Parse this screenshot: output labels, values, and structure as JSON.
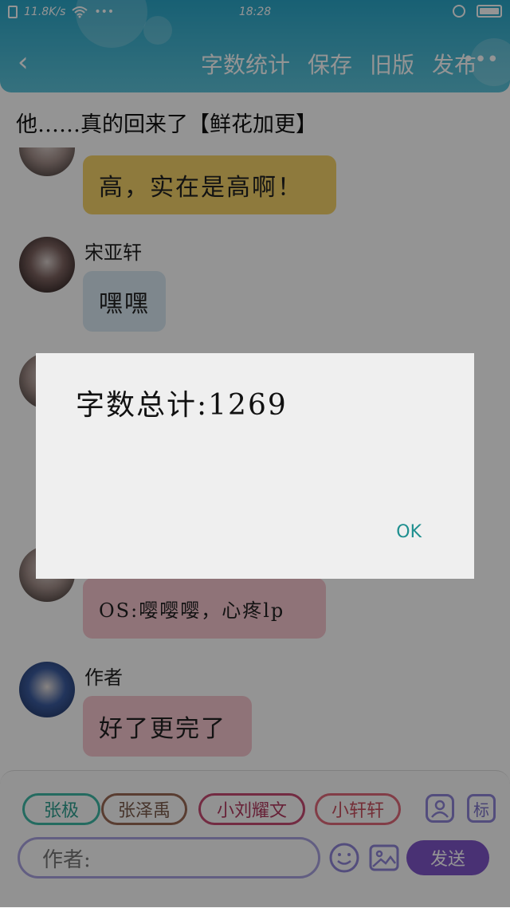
{
  "status_bar": {
    "speed": "11.8K/s",
    "dots": "•••",
    "time": "18:28"
  },
  "header": {
    "back": "‹",
    "actions": [
      "字数统计",
      "保存",
      "旧版",
      "发布"
    ],
    "more": "•••"
  },
  "title": "他……真的回来了【鲜花加更】",
  "messages": [
    {
      "sender": "",
      "text": "高，实在是高啊！",
      "color": "yellow"
    },
    {
      "sender": "宋亚轩",
      "text": "嘿嘿",
      "color": "blue"
    },
    {
      "sender": "",
      "text": "OS:嘤嘤嘤，心疼lp",
      "color": "pink"
    },
    {
      "sender": "作者",
      "text": "好了更完了",
      "color": "pink"
    }
  ],
  "chips": [
    "张极",
    "张泽禹",
    "小刘耀文",
    "小轩轩"
  ],
  "tag_label": "标",
  "input": {
    "value": "作者:"
  },
  "send_label": "发送",
  "dialog": {
    "text": "字数总计:1269",
    "ok": "OK"
  }
}
